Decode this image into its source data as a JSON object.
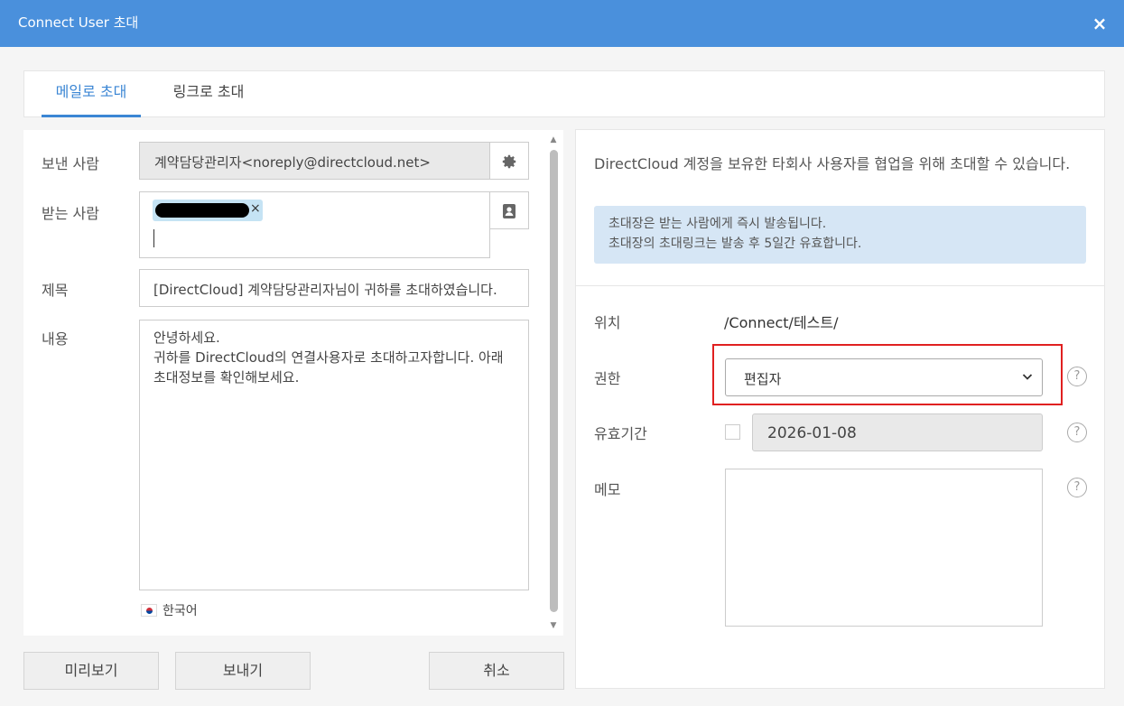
{
  "dialog": {
    "title": "Connect User 초대",
    "close_label": "×"
  },
  "tabs": [
    {
      "label": "메일로 초대",
      "active": true
    },
    {
      "label": "링크로 초대",
      "active": false
    }
  ],
  "mail_form": {
    "sender_label": "보낸 사람",
    "sender_value": "계약담당관리자<noreply@directcloud.net>",
    "recipient_label": "받는 사람",
    "recipient_chip_remove": "×",
    "subject_label": "제목",
    "subject_value": "[DirectCloud] 계약담당관리자님이 귀하를 초대하였습니다.",
    "content_label": "내용",
    "content_lines": [
      "안녕하세요.",
      "귀하를 DirectCloud의 연결사용자로 초대하고자합니다. 아래 초대정보를 확인해보세요."
    ],
    "language": "한국어"
  },
  "buttons": {
    "preview": "미리보기",
    "send": "보내기",
    "cancel": "취소"
  },
  "info": {
    "description": "DirectCloud 계정을 보유한 타회사 사용자를 협업을 위해 초대할 수 있습니다.",
    "notice_line1": "초대장은 받는 사람에게 즉시 발송됩니다.",
    "notice_line2": "초대장의 초대링크는 발송 후 5일간 유효합니다."
  },
  "settings": {
    "location_label": "위치",
    "location_value": "/Connect/테스트/",
    "permission_label": "권한",
    "permission_value": "편집자",
    "expiry_label": "유효기간",
    "expiry_value": "2026-01-08",
    "memo_label": "메모",
    "help_glyph": "?"
  },
  "colors": {
    "titlebar": "#4a90dc",
    "accent": "#3b86d4",
    "highlight": "#e02020",
    "notice_bg": "#d6e6f5"
  }
}
